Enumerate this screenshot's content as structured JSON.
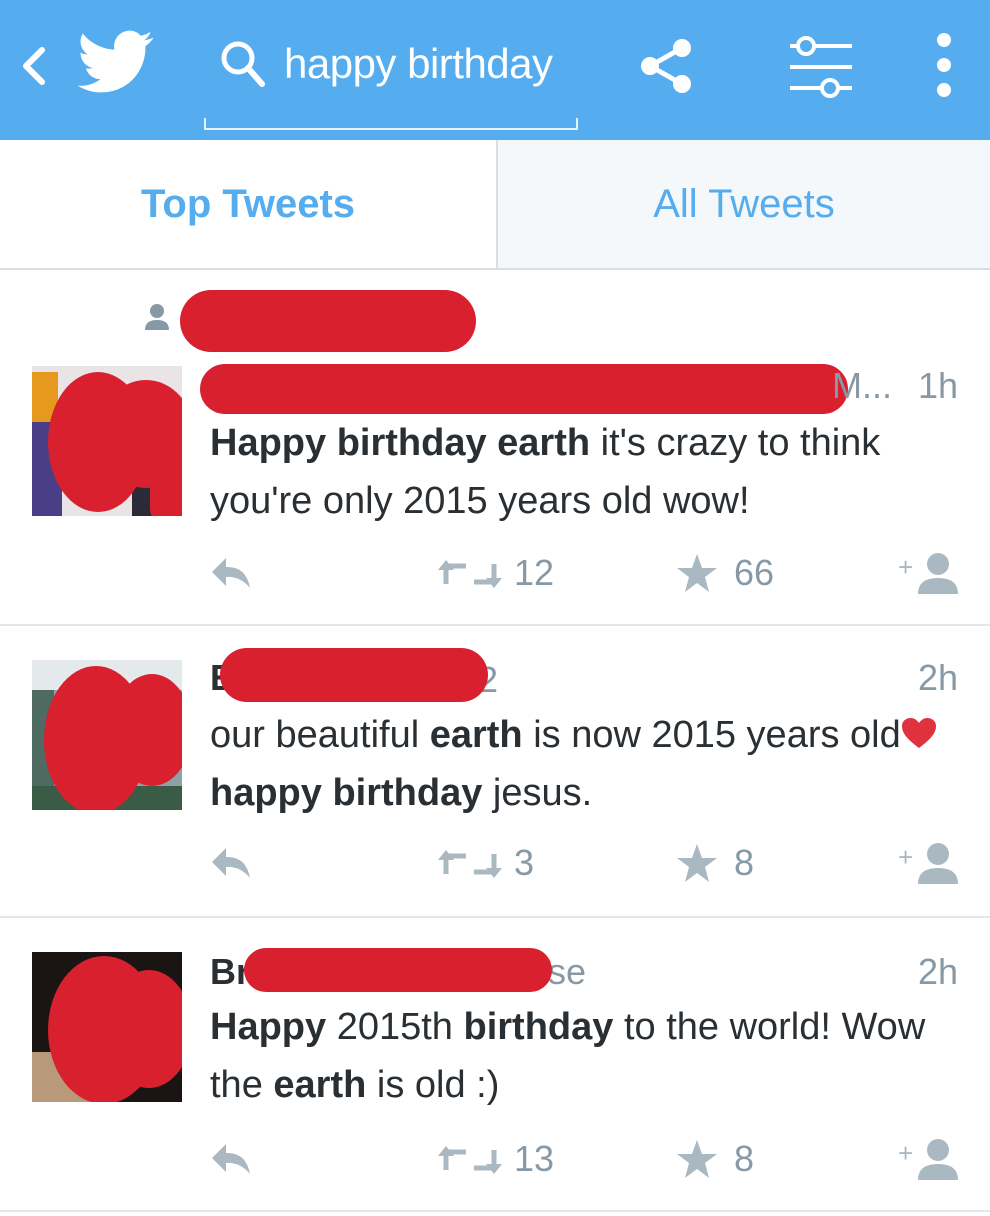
{
  "header": {
    "search_query": "happy birthday",
    "icons": [
      "back-icon",
      "twitter-bird-icon",
      "search-icon",
      "share-icon",
      "filter-icon",
      "overflow-menu-icon"
    ],
    "bar_color": "#55acee"
  },
  "tabs": [
    {
      "label": "Top Tweets",
      "selected": true
    },
    {
      "label": "All Tweets",
      "selected": false
    }
  ],
  "social_context": {
    "icon": "person-icon"
  },
  "tweets": [
    {
      "name_fragment": "",
      "handle_fragment": "M...",
      "time": "1h",
      "text_parts": [
        {
          "t": "Happy birthday earth",
          "bold": true
        },
        {
          "t": " it's crazy to think you're only 2015 years old wow!",
          "bold": false
        }
      ],
      "retweets": "12",
      "favorites": "66"
    },
    {
      "name_fragment": "E",
      "handle_fragment": "2",
      "time": "2h",
      "text_parts": [
        {
          "t": "our beautiful ",
          "bold": false
        },
        {
          "t": "earth",
          "bold": true
        },
        {
          "t": " is now 2015 years old",
          "bold": false
        },
        {
          "t": "heart",
          "emoji": true
        },
        {
          "t": " happy birthday",
          "bold": true
        },
        {
          "t": " jesus.",
          "bold": false
        }
      ],
      "retweets": "3",
      "favorites": "8"
    },
    {
      "name_fragment": "Br",
      "handle_fragment": "se",
      "time": "2h",
      "text_parts": [
        {
          "t": "Happy",
          "bold": true
        },
        {
          "t": " 2015th ",
          "bold": false
        },
        {
          "t": "birthday",
          "bold": true
        },
        {
          "t": " to the world! Wow the ",
          "bold": false
        },
        {
          "t": "earth",
          "bold": true
        },
        {
          "t": " is old :)",
          "bold": false
        }
      ],
      "retweets": "13",
      "favorites": "8"
    }
  ],
  "colors": {
    "accent": "#55acee",
    "redaction": "#d8202e",
    "muted": "#8899a6",
    "text": "#292f33"
  }
}
